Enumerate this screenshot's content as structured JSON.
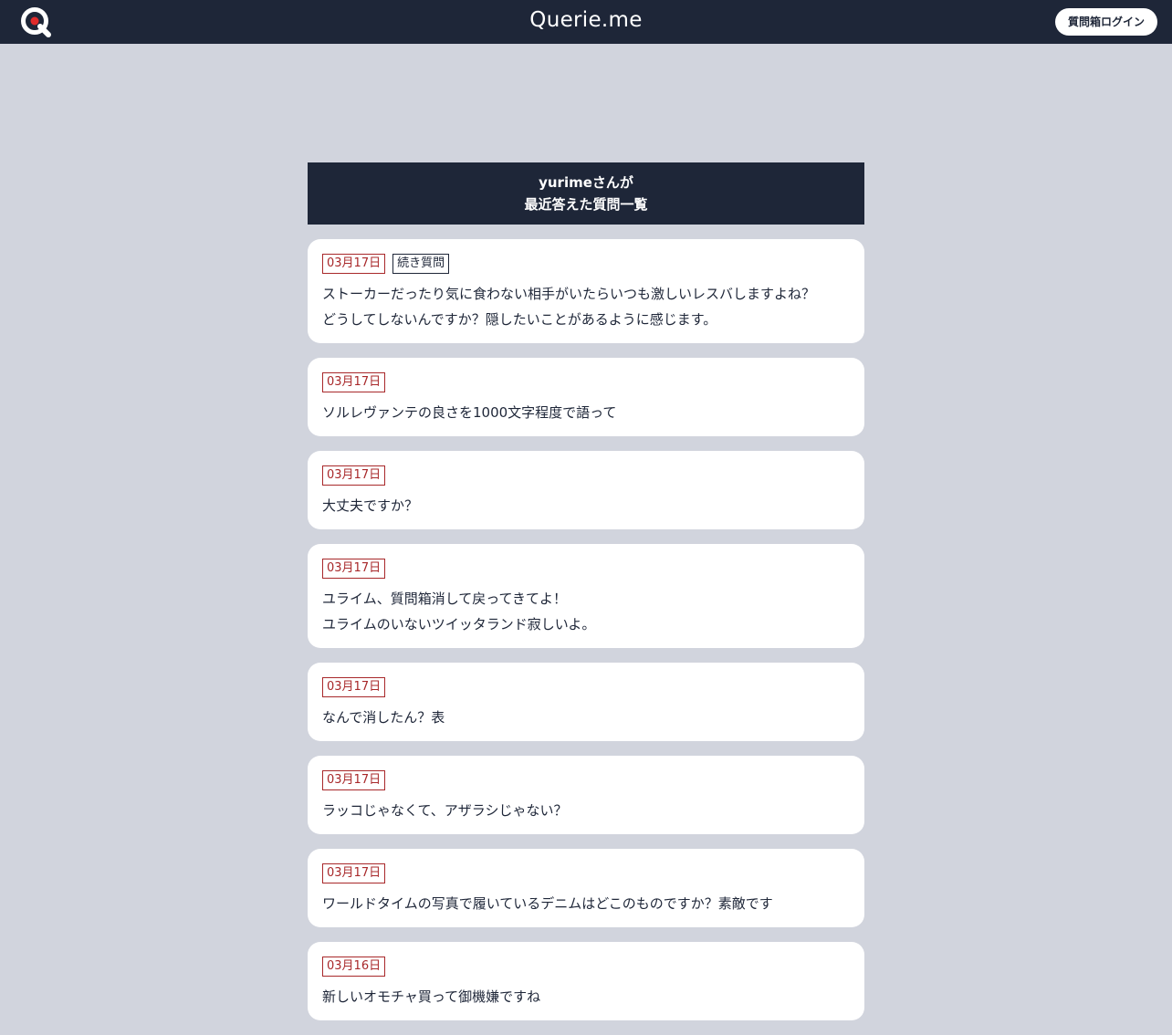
{
  "topbar": {
    "brand": "Querie.me",
    "login_label": "質問箱ログイン",
    "logo_color": "#ffffff",
    "logo_accent": "#e02a2a"
  },
  "panel": {
    "line1": "yurimeさんが",
    "line2": "最近答えた質問一覧"
  },
  "questions": [
    {
      "date": "03月17日",
      "tag": "続き質問",
      "lines": [
        "ストーカーだったり気に食わない相手がいたらいつも激しいレスバしますよね？",
        "どうしてしないんですか？隠したいことがあるように感じます。"
      ]
    },
    {
      "date": "03月17日",
      "tag": "",
      "lines": [
        "ソルレヴァンテの良さを1000文字程度で語って"
      ]
    },
    {
      "date": "03月17日",
      "tag": "",
      "lines": [
        "大丈夫ですか？"
      ]
    },
    {
      "date": "03月17日",
      "tag": "",
      "lines": [
        "ユライム、質問箱消して戻ってきてよ！",
        "ユライムのいないツイッタランド寂しいよ。"
      ]
    },
    {
      "date": "03月17日",
      "tag": "",
      "lines": [
        "なんで消したん？表"
      ]
    },
    {
      "date": "03月17日",
      "tag": "",
      "lines": [
        "ラッコじゃなくて、アザラシじゃない？"
      ]
    },
    {
      "date": "03月17日",
      "tag": "",
      "lines": [
        "ワールドタイムの写真で履いているデニムはどこのものですか？素敵です"
      ]
    },
    {
      "date": "03月16日",
      "tag": "",
      "lines": [
        "新しいオモチャ買って御機嫌ですね"
      ]
    }
  ]
}
